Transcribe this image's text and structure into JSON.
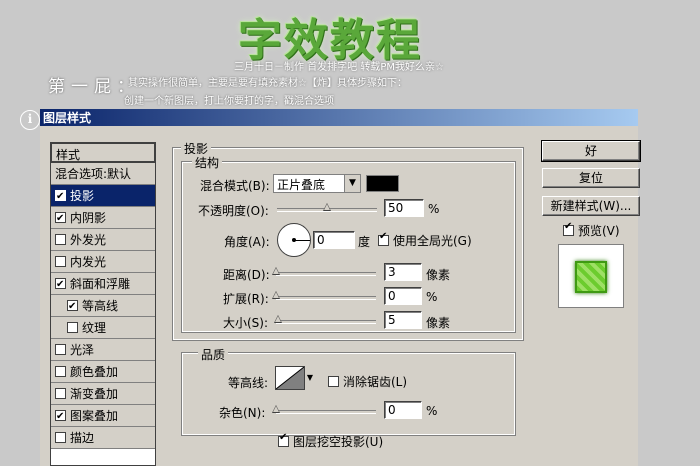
{
  "banner": {
    "title": "字效教程",
    "credits": "三月十日－制作 首发排字吧 转载PM我好么亲☆",
    "step": "第一屁：",
    "intro_line1": "其实操作很简单，主要是要有填充素材☆【炸】具体步骤如下：",
    "intro_line2": "创建一个新图层，打上你要打的字，戳混合选项"
  },
  "dialog": {
    "title": "图层样式",
    "styles_header": "样式",
    "blend_options": "混合选项:默认",
    "styles": [
      {
        "label": "投影",
        "checked": true,
        "selected": true,
        "sub": false
      },
      {
        "label": "内阴影",
        "checked": true,
        "selected": false,
        "sub": false
      },
      {
        "label": "外发光",
        "checked": false,
        "selected": false,
        "sub": false
      },
      {
        "label": "内发光",
        "checked": false,
        "selected": false,
        "sub": false
      },
      {
        "label": "斜面和浮雕",
        "checked": true,
        "selected": false,
        "sub": false
      },
      {
        "label": "等高线",
        "checked": true,
        "selected": false,
        "sub": true
      },
      {
        "label": "纹理",
        "checked": false,
        "selected": false,
        "sub": true
      },
      {
        "label": "光泽",
        "checked": false,
        "selected": false,
        "sub": false
      },
      {
        "label": "颜色叠加",
        "checked": false,
        "selected": false,
        "sub": false
      },
      {
        "label": "渐变叠加",
        "checked": false,
        "selected": false,
        "sub": false
      },
      {
        "label": "图案叠加",
        "checked": true,
        "selected": false,
        "sub": false
      },
      {
        "label": "描边",
        "checked": false,
        "selected": false,
        "sub": false
      }
    ],
    "drop_shadow": {
      "group_title": "投影",
      "structure_title": "结构",
      "blend_mode_label": "混合模式(B):",
      "blend_mode_value": "正片叠底",
      "shadow_color": "#000000",
      "opacity_label": "不透明度(O):",
      "opacity_value": "50",
      "opacity_unit": "%",
      "opacity_slider": 0.5,
      "angle_label": "角度(A):",
      "angle_value": "0",
      "angle_unit": "度",
      "global_light_label": "使用全局光(G)",
      "global_light_checked": true,
      "distance_label": "距离(D):",
      "distance_value": "3",
      "distance_unit": "像素",
      "spread_label": "扩展(R):",
      "spread_value": "0",
      "spread_unit": "%",
      "size_label": "大小(S):",
      "size_value": "5",
      "size_unit": "像素"
    },
    "quality": {
      "title": "品质",
      "contour_label": "等高线:",
      "anti_alias_label": "消除锯齿(L)",
      "anti_alias_checked": false,
      "noise_label": "杂色(N):",
      "noise_value": "0",
      "noise_unit": "%",
      "knockout_label": "图层挖空投影(U)",
      "knockout_checked": true
    },
    "buttons": {
      "ok": "好",
      "reset": "复位",
      "new_style": "新建样式(W)...",
      "preview_label": "预览(V)",
      "preview_checked": true
    }
  }
}
